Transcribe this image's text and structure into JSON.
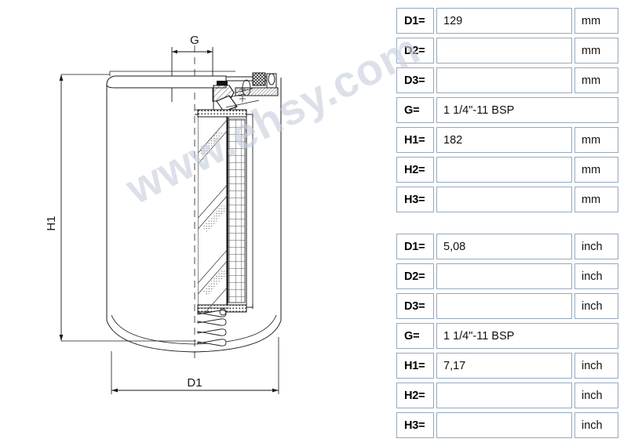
{
  "watermark": {
    "text": "www.ehsy.com"
  },
  "drawing": {
    "title": "filter-cartridge-cross-section",
    "dimension_labels": {
      "g": "G",
      "h1": "H1",
      "d1": "D1"
    }
  },
  "tables": [
    {
      "id": "mm",
      "unit": "mm",
      "rows": [
        {
          "label": "D1=",
          "value": "129",
          "unit": "mm",
          "wide": false
        },
        {
          "label": "D2=",
          "value": "",
          "unit": "mm",
          "wide": false
        },
        {
          "label": "D3=",
          "value": "",
          "unit": "mm",
          "wide": false
        },
        {
          "label": "G=",
          "value": "1 1/4\"-11 BSP",
          "unit": "",
          "wide": true
        },
        {
          "label": "H1=",
          "value": "182",
          "unit": "mm",
          "wide": false
        },
        {
          "label": "H2=",
          "value": "",
          "unit": "mm",
          "wide": false
        },
        {
          "label": "H3=",
          "value": "",
          "unit": "mm",
          "wide": false
        }
      ]
    },
    {
      "id": "inch",
      "unit": "inch",
      "rows": [
        {
          "label": "D1=",
          "value": "5,08",
          "unit": "inch",
          "wide": false
        },
        {
          "label": "D2=",
          "value": "",
          "unit": "inch",
          "wide": false
        },
        {
          "label": "D3=",
          "value": "",
          "unit": "inch",
          "wide": false
        },
        {
          "label": "G=",
          "value": "1 1/4\"-11 BSP",
          "unit": "",
          "wide": true
        },
        {
          "label": "H1=",
          "value": "7,17",
          "unit": "inch",
          "wide": false
        },
        {
          "label": "H2=",
          "value": "",
          "unit": "inch",
          "wide": false
        },
        {
          "label": "H3=",
          "value": "",
          "unit": "inch",
          "wide": false
        }
      ]
    }
  ],
  "colors": {
    "cell_border": "#95a9bf",
    "line": "#1a1a1a",
    "watermark": "#c8cfdc",
    "background": "#ffffff"
  }
}
